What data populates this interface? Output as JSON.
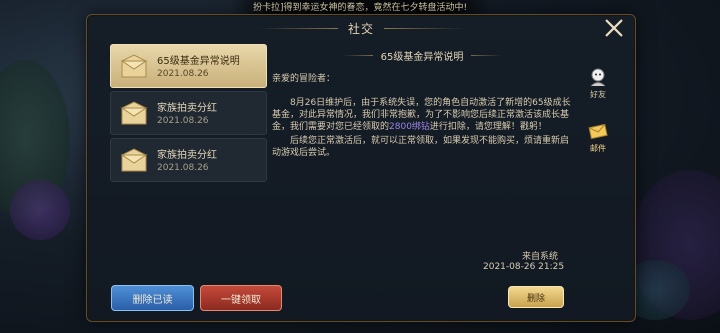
{
  "ticker": "扮卡拉]得到幸运女神的眷恋，竟然在七夕转盘活动中!",
  "panel": {
    "title": "社交"
  },
  "mail_list": [
    {
      "title": "65级基金异常说明",
      "date": "2021.08.26",
      "active": true
    },
    {
      "title": "家族拍卖分红",
      "date": "2021.08.26",
      "active": false
    },
    {
      "title": "家族拍卖分红",
      "date": "2021.08.26",
      "active": false
    }
  ],
  "mail_detail": {
    "title": "65级基金异常说明",
    "greeting": "亲爱的冒险者：",
    "para1_a": "8月26日维护后，由于系统失误，您的角色自动激活了新增的65级成长基金，对此异常情况，我们非常抱歉，为了不影响您后续正常激活该成长基金，我们需要对您已经领取的",
    "para1_highlight": "2800绑钻",
    "para1_b": "进行扣除，请您理解！戳躬！",
    "para2": "后续您正常激活后，就可以正常领取，如果发现不能购买，烦请重新启动游戏后尝试。",
    "sender": "来自系统",
    "time": "2021-08-26  21:25"
  },
  "right_tabs": [
    {
      "label": "好友",
      "icon": "friends-icon",
      "active": false
    },
    {
      "label": "邮件",
      "icon": "mail-icon",
      "active": true
    }
  ],
  "buttons": {
    "delete_read": "删除已读",
    "claim_all": "一键领取",
    "delete": "删除"
  },
  "colors": {
    "gold": "#e8d7aa",
    "highlight": "#9a86e8",
    "blue_button": "#3a74c0",
    "red_button": "#a83a2c"
  }
}
